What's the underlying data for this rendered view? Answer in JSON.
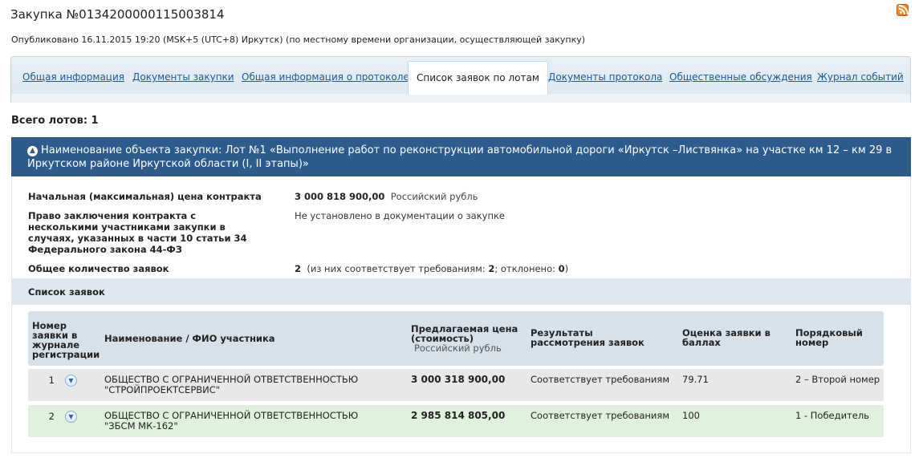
{
  "header": {
    "title": "Закупка №0134200000115003814",
    "published": "Опубликовано 16.11.2015 19:20 (MSK+5 (UTC+8) Иркутск) (по местному времени организации, осуществляющей закупку)",
    "rss_icon": "rss-icon"
  },
  "tabs": [
    {
      "label": "Общая информация"
    },
    {
      "label": "Документы закупки"
    },
    {
      "label": "Общая информация о протоколе"
    },
    {
      "label": "Список заявок по лотам",
      "active": true
    },
    {
      "label": "Документы протокола"
    },
    {
      "label": "Общественные обсуждения"
    },
    {
      "label": "Журнал событий"
    }
  ],
  "total_lots": "Всего лотов: 1",
  "lot": {
    "header": "Наименование объекта закупки: Лот №1 «Выполнение работ по реконструкции автомобильной дороги «Иркутск –Листвянка» на участке км 12 – км 29 в Иркутском районе Иркутской области (I, II этапы)»",
    "collapse_icon": "chevron-up-icon",
    "fields": {
      "price_label": "Начальная (максимальная) цена контракта",
      "price_value": "3 000 818 900,00",
      "price_currency": "Российский рубль",
      "right_label": "Право заключения контракта с несколькими участниками закупки в случаях, указанных в части 10 статьи 34 Федерального закона 44-ФЗ",
      "right_value": "Не установлено в документации о закупке",
      "count_label": "Общее количество заявок",
      "count_value": "2",
      "count_open": "(из них соответствует требованиям:",
      "count_matching": "2",
      "count_sep": ";  отклонено:",
      "count_rejected": "0",
      "count_close": ")"
    },
    "bids_title": "Список заявок",
    "table": {
      "columns": {
        "number": "Номер заявки в журнале регистрации",
        "name": "Наименование / ФИО участника",
        "price": "Предлагаемая цена (стоимость)",
        "price_sub": "Российский рубль",
        "result": "Результаты рассмотрения заявок",
        "score": "Оценка заявки в баллах",
        "rank": "Порядковый номер"
      },
      "rows": [
        {
          "number": "1",
          "name": "ОБЩЕСТВО С ОГРАНИЧЕННОЙ ОТВЕТСТВЕННОСТЬЮ \"СТРОЙПРОЕКТСЕРВИС\"",
          "price": "3 000 318 900,00",
          "result": "Соответствует требованиям",
          "score": "79.71",
          "rank": "2 – Второй номер"
        },
        {
          "number": "2",
          "name": "ОБЩЕСТВО С ОГРАНИЧЕННОЙ ОТВЕТСТВЕННОСТЬЮ \"ЗБСМ МК-162\"",
          "price": "2 985 814 805,00",
          "result": "Соответствует требованиям",
          "score": "100",
          "rank": "1 - Победитель"
        }
      ]
    }
  },
  "colors": {
    "lot_header_bg": "#2d5b8c",
    "link": "#1a5a96",
    "winner_row_bg": "#dff2dc",
    "row_bg": "#e8e8e8"
  }
}
